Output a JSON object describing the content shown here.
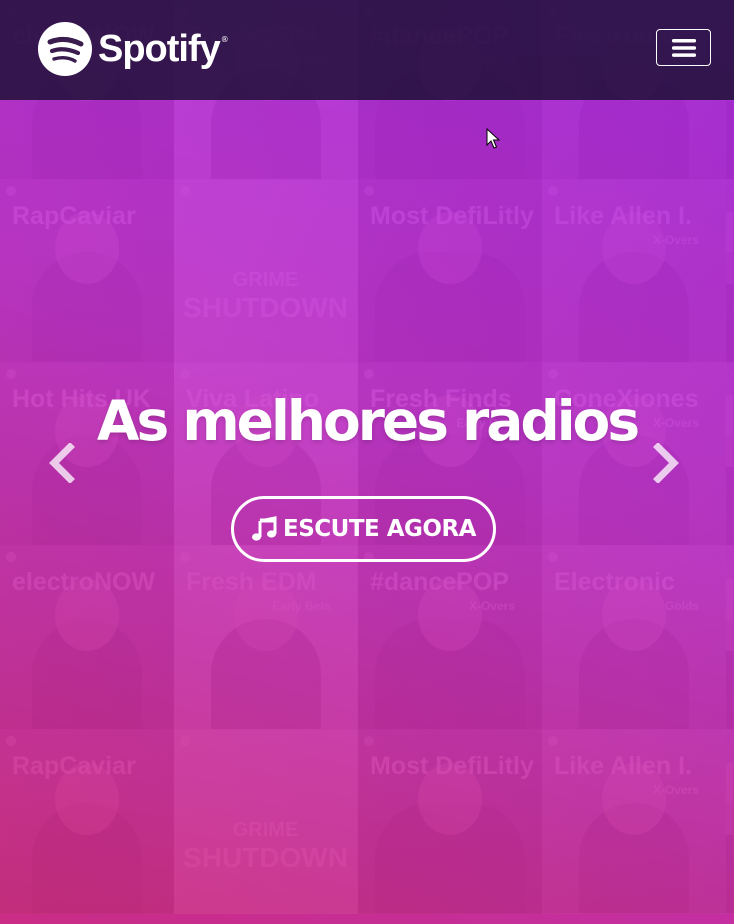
{
  "brand": {
    "name": "Spotify",
    "reg_mark": "®",
    "icon": "spotify-logo-icon"
  },
  "nav": {
    "menu_icon": "hamburger-menu-icon"
  },
  "hero": {
    "headline": "As melhores radios",
    "cta_label": "ESCUTE AGORA",
    "cta_icon": "music-note-icon",
    "prev_icon": "chevron-left-icon",
    "next_icon": "chevron-right-icon"
  },
  "background_tiles": [
    {
      "title": "electroNOW",
      "subtitle": ""
    },
    {
      "title": "Fresh EDM",
      "subtitle": "Early Bets"
    },
    {
      "title": "#dancePOP",
      "subtitle": "X-Overs"
    },
    {
      "title": "Electronic",
      "subtitle": "Golds"
    },
    {
      "title": "",
      "subtitle": ""
    },
    {
      "title": "RapCaviar",
      "subtitle": ""
    },
    {
      "title": "GRIME",
      "subtitle": "SHUTDOWN"
    },
    {
      "title": "Most DefiLitly",
      "subtitle": ""
    },
    {
      "title": "Like Allen I.",
      "subtitle": "X-Overs"
    },
    {
      "title": "",
      "subtitle": ""
    },
    {
      "title": "Hot Hits UK",
      "subtitle": ""
    },
    {
      "title": "Viva Latino",
      "subtitle": ""
    },
    {
      "title": "Fresh Finds",
      "subtitle": "Early Bets"
    },
    {
      "title": "ConeXiones",
      "subtitle": "X-Overs"
    },
    {
      "title": "",
      "subtitle": ""
    },
    {
      "title": "electroNOW",
      "subtitle": ""
    },
    {
      "title": "Fresh EDM",
      "subtitle": "Early Bets"
    },
    {
      "title": "#dancePOP",
      "subtitle": "X-Overs"
    },
    {
      "title": "Electronic",
      "subtitle": "Golds"
    },
    {
      "title": "",
      "subtitle": ""
    },
    {
      "title": "RapCaviar",
      "subtitle": ""
    },
    {
      "title": "GRIME",
      "subtitle": "SHUTDOWN"
    },
    {
      "title": "Most DefiLitly",
      "subtitle": ""
    },
    {
      "title": "Like Allen I.",
      "subtitle": "X-Overs"
    },
    {
      "title": "",
      "subtitle": ""
    }
  ],
  "colors": {
    "overlay_top": "#b028e6",
    "overlay_bottom": "#d72d82",
    "navbar": "#1e1037",
    "text": "#ffffff"
  }
}
